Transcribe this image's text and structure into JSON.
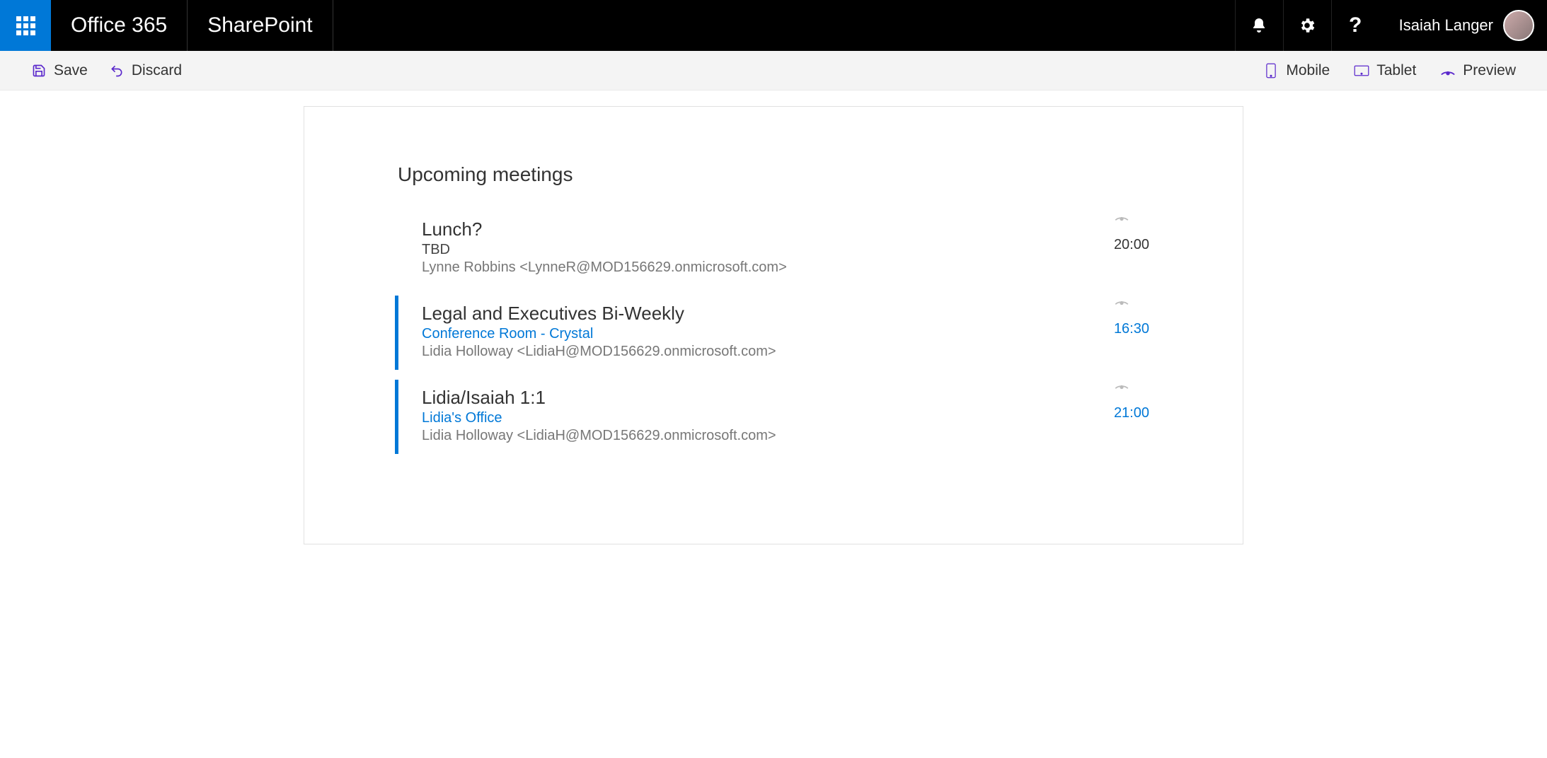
{
  "suite": {
    "brand": "Office 365",
    "app": "SharePoint",
    "user_name": "Isaiah Langer"
  },
  "cmd": {
    "save": "Save",
    "discard": "Discard",
    "mobile": "Mobile",
    "tablet": "Tablet",
    "preview": "Preview"
  },
  "section": {
    "title": "Upcoming meetings"
  },
  "meetings": [
    {
      "title": "Lunch?",
      "location": "TBD",
      "location_link": false,
      "organizer": "Lynne Robbins <LynneR@MOD156629.onmicrosoft.com>",
      "time": "20:00",
      "time_link": false,
      "selected": false
    },
    {
      "title": "Legal and Executives Bi-Weekly",
      "location": "Conference Room - Crystal",
      "location_link": true,
      "organizer": "Lidia Holloway <LidiaH@MOD156629.onmicrosoft.com>",
      "time": "16:30",
      "time_link": true,
      "selected": true
    },
    {
      "title": "Lidia/Isaiah 1:1",
      "location": "Lidia's Office",
      "location_link": true,
      "organizer": "Lidia Holloway <LidiaH@MOD156629.onmicrosoft.com>",
      "time": "21:00",
      "time_link": true,
      "selected": true
    }
  ]
}
